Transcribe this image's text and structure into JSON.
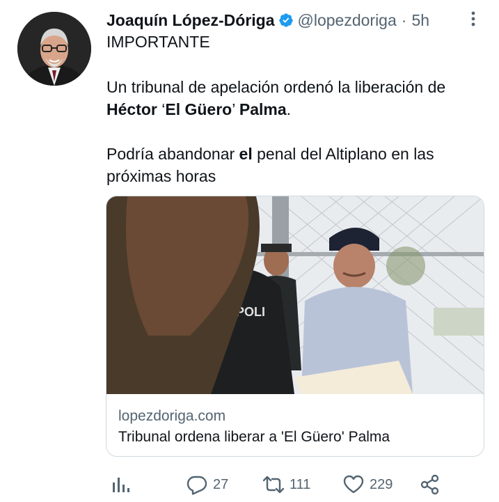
{
  "tweet": {
    "author_name": "Joaquín López-Dóriga",
    "handle": "@lopezdoriga",
    "separator": "·",
    "time": "5h",
    "line1": "IMPORTANTE",
    "line2": "Un tribunal de apelación ordenó la liberación de",
    "line3_name": "Héctor",
    "line3_q1": "‘",
    "line3_nick": "El Güero",
    "line3_q2": "’",
    "line3_last": "Palma",
    "line3_end": ".",
    "line4_a": "Podría abandonar ",
    "line4_b": "el",
    "line4_c": " penal del Altiplano en las",
    "line5": "próximas horas"
  },
  "card": {
    "domain": "lopezdoriga.com",
    "title": "Tribunal ordena liberar a 'El Güero' Palma",
    "photo_text": "POLI"
  },
  "actions": {
    "replies": "27",
    "retweets": "111",
    "likes": "229"
  },
  "colors": {
    "verified": "#1d9bf0",
    "muted": "#536471",
    "text": "#0f1419",
    "border": "#cfd9de"
  },
  "icons": [
    "verified-badge-icon",
    "more-options-icon",
    "analytics-icon",
    "reply-icon",
    "retweet-icon",
    "like-icon",
    "share-icon"
  ]
}
